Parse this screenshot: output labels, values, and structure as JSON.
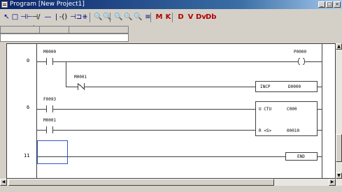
{
  "window": {
    "title": "Program [New Project1]",
    "controls": {
      "minimize": "_",
      "maximize": "□",
      "close": "×"
    }
  },
  "toolbar": {
    "tools": [
      {
        "name": "select-arrow-icon",
        "glyph": "↖"
      },
      {
        "name": "box-icon",
        "glyph": "□"
      },
      {
        "name": "contact-no-icon",
        "glyph": "⊣⊢"
      },
      {
        "name": "contact-nc-icon",
        "glyph": "⊣/⊢"
      },
      {
        "name": "horizontal-line-icon",
        "glyph": "—"
      },
      {
        "name": "vertical-line-icon",
        "glyph": "|"
      },
      {
        "name": "coil-icon",
        "glyph": "-()"
      },
      {
        "name": "function-box-icon",
        "glyph": "⊣⊐"
      },
      {
        "name": "compare-icon",
        "glyph": "⧺"
      },
      {
        "name": "zoom-in-icon",
        "glyph": "🔍"
      },
      {
        "name": "zoom-out-icon",
        "glyph": "🔍"
      },
      {
        "name": "find-icon",
        "glyph": "🔍"
      },
      {
        "name": "find-next-icon",
        "glyph": "🔍"
      },
      {
        "name": "find-device-icon",
        "glyph": "🔍"
      },
      {
        "name": "list-icon",
        "glyph": "≡"
      },
      {
        "name": "monitor-icon",
        "glyph": "M"
      },
      {
        "name": "monitor-stop-icon",
        "glyph": "K"
      },
      {
        "name": "device-d-icon",
        "glyph": "D"
      },
      {
        "name": "device-v-icon",
        "glyph": "V"
      },
      {
        "name": "device-dv-icon",
        "glyph": "Dv"
      },
      {
        "name": "device-db-icon",
        "glyph": "Db"
      }
    ]
  },
  "ladder": {
    "steps": [
      "0",
      "6",
      "11"
    ],
    "rung0": {
      "contact1": "M0000",
      "coil": "P0000",
      "contact2": "M0001",
      "instruction": "INCP",
      "instruction_operand": "D0000"
    },
    "rung1": {
      "contact1": "F0093",
      "counter_type": "U CTU",
      "counter_name": "C000",
      "contact2": "M0001",
      "reset_label": "R <S>",
      "preset": "00010"
    },
    "rung2": {
      "end": "END"
    }
  },
  "scrollbar": {
    "up": "▲",
    "down": "▼",
    "left": "◀",
    "right": "▶"
  }
}
